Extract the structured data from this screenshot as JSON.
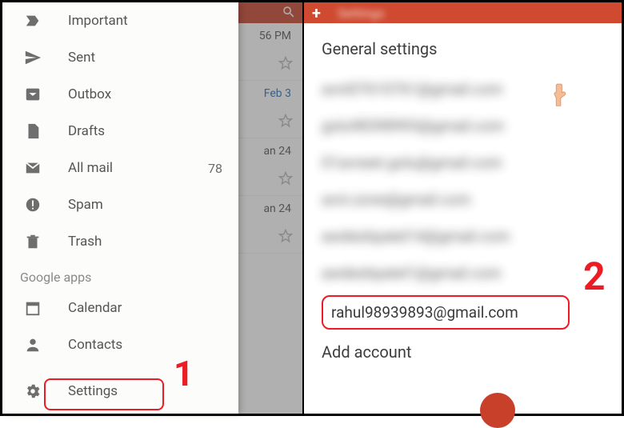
{
  "left": {
    "nav_items": [
      {
        "label": "Important",
        "count": ""
      },
      {
        "label": "Sent",
        "count": ""
      },
      {
        "label": "Outbox",
        "count": ""
      },
      {
        "label": "Drafts",
        "count": ""
      },
      {
        "label": "All mail",
        "count": "78"
      },
      {
        "label": "Spam",
        "count": ""
      },
      {
        "label": "Trash",
        "count": ""
      }
    ],
    "section": "Google apps",
    "apps": [
      {
        "label": "Calendar"
      },
      {
        "label": "Contacts"
      },
      {
        "label": "Settings"
      }
    ],
    "annotation_1": "1",
    "backdrop": {
      "rows": [
        {
          "date": "56 PM"
        },
        {
          "date": "Feb 3"
        },
        {
          "date": "an 24"
        },
        {
          "date": "an 24"
        }
      ]
    }
  },
  "right": {
    "header_title": "Settings",
    "general": "General settings",
    "blurred_accounts": [
      "avni07610761@gmail.com",
      "golu98398993@gmail.com",
      "01avneet.golu@gmail.com",
      "avni.zone@gmail.com",
      "awdeshpatel14@gmail.com",
      "awdeshpatel1@gmail.com"
    ],
    "highlight_account": "rahul98939893@gmail.com",
    "add_account": "Add account",
    "annotation_2": "2"
  }
}
